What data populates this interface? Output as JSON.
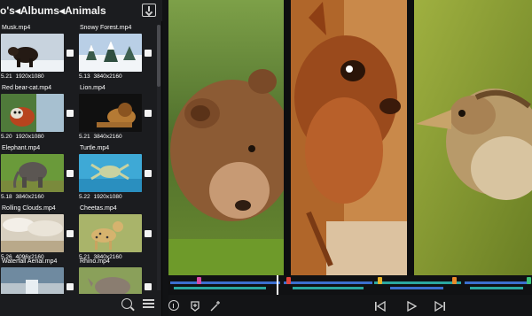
{
  "breadcrumb": {
    "parts": [
      "o's",
      "Albums",
      "Animals"
    ],
    "separator": "◂"
  },
  "browser": {
    "items": [
      {
        "name": "Musk.mp4",
        "meta": "5.21 1920x1080"
      },
      {
        "name": "Snowy Forest.mp4",
        "meta": "5.13 3840x2160"
      },
      {
        "name": "Red bear-cat.mp4",
        "meta": "5.20 1920x1080"
      },
      {
        "name": "Lion.mp4",
        "meta": "5.21 3840x2160"
      },
      {
        "name": "Elephant.mp4",
        "meta": "5.18 3840x2160"
      },
      {
        "name": "Turtle.mp4",
        "meta": "5.22 1920x1080"
      },
      {
        "name": "Rolling Clouds.mp4",
        "meta": "5.26 4096x2160"
      },
      {
        "name": "Cheetas.mp4",
        "meta": "5.21 3840x2160"
      },
      {
        "name": "Waterfall Aerial.mp4",
        "meta": ""
      },
      {
        "name": "Rhino.mp4",
        "meta": ""
      }
    ]
  },
  "colors": {
    "marker_magenta": "#d84aa8",
    "marker_red": "#e2443c",
    "marker_yellow": "#e6b428",
    "marker_orange": "#e98a2a",
    "marker_green": "#39c07a",
    "track_blue": "#3b6fcf",
    "track_teal": "#2aa7a0"
  },
  "icons": {
    "import": "import-icon",
    "search": "search-icon",
    "list": "list-icon",
    "info": "info-icon",
    "add_marker": "add-marker-icon",
    "effects": "effects-icon",
    "prev": "previous-icon",
    "play": "play-icon",
    "next": "next-icon"
  }
}
